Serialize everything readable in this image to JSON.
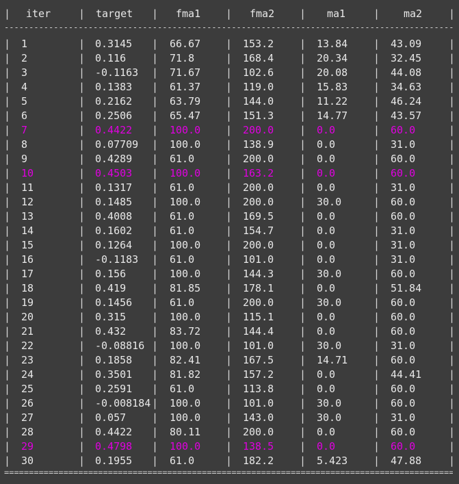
{
  "columns": [
    "iter",
    "target",
    "fma1",
    "fma2",
    "ma1",
    "ma2"
  ],
  "separator_char": "-",
  "footer_char": "=",
  "highlight_color": "#e000e0",
  "rows": [
    {
      "cells": [
        "1",
        "0.3145",
        "66.67",
        "153.2",
        "13.84",
        "43.09"
      ],
      "highlight": false
    },
    {
      "cells": [
        "2",
        "0.116",
        "71.8",
        "168.4",
        "20.34",
        "32.45"
      ],
      "highlight": false
    },
    {
      "cells": [
        "3",
        "-0.1163",
        "71.67",
        "102.6",
        "20.08",
        "44.08"
      ],
      "highlight": false
    },
    {
      "cells": [
        "4",
        "0.1383",
        "61.37",
        "119.0",
        "15.83",
        "34.63"
      ],
      "highlight": false
    },
    {
      "cells": [
        "5",
        "0.2162",
        "63.79",
        "144.0",
        "11.22",
        "46.24"
      ],
      "highlight": false
    },
    {
      "cells": [
        "6",
        "0.2506",
        "65.47",
        "151.3",
        "14.77",
        "43.57"
      ],
      "highlight": false
    },
    {
      "cells": [
        "7",
        "0.4422",
        "100.0",
        "200.0",
        "0.0",
        "60.0"
      ],
      "highlight": true
    },
    {
      "cells": [
        "8",
        "0.07709",
        "100.0",
        "138.9",
        "0.0",
        "31.0"
      ],
      "highlight": false
    },
    {
      "cells": [
        "9",
        "0.4289",
        "61.0",
        "200.0",
        "0.0",
        "60.0"
      ],
      "highlight": false
    },
    {
      "cells": [
        "10",
        "0.4503",
        "100.0",
        "163.2",
        "0.0",
        "60.0"
      ],
      "highlight": true
    },
    {
      "cells": [
        "11",
        "0.1317",
        "61.0",
        "200.0",
        "0.0",
        "31.0"
      ],
      "highlight": false
    },
    {
      "cells": [
        "12",
        "0.1485",
        "100.0",
        "200.0",
        "30.0",
        "60.0"
      ],
      "highlight": false
    },
    {
      "cells": [
        "13",
        "0.4008",
        "61.0",
        "169.5",
        "0.0",
        "60.0"
      ],
      "highlight": false
    },
    {
      "cells": [
        "14",
        "0.1602",
        "61.0",
        "154.7",
        "0.0",
        "31.0"
      ],
      "highlight": false
    },
    {
      "cells": [
        "15",
        "0.1264",
        "100.0",
        "200.0",
        "0.0",
        "31.0"
      ],
      "highlight": false
    },
    {
      "cells": [
        "16",
        "-0.1183",
        "61.0",
        "101.0",
        "0.0",
        "31.0"
      ],
      "highlight": false
    },
    {
      "cells": [
        "17",
        "0.156",
        "100.0",
        "144.3",
        "30.0",
        "60.0"
      ],
      "highlight": false
    },
    {
      "cells": [
        "18",
        "0.419",
        "81.85",
        "178.1",
        "0.0",
        "51.84"
      ],
      "highlight": false
    },
    {
      "cells": [
        "19",
        "0.1456",
        "61.0",
        "200.0",
        "30.0",
        "60.0"
      ],
      "highlight": false
    },
    {
      "cells": [
        "20",
        "0.315",
        "100.0",
        "115.1",
        "0.0",
        "60.0"
      ],
      "highlight": false
    },
    {
      "cells": [
        "21",
        "0.432",
        "83.72",
        "144.4",
        "0.0",
        "60.0"
      ],
      "highlight": false
    },
    {
      "cells": [
        "22",
        "-0.08816",
        "100.0",
        "101.0",
        "30.0",
        "31.0"
      ],
      "highlight": false
    },
    {
      "cells": [
        "23",
        "0.1858",
        "82.41",
        "167.5",
        "14.71",
        "60.0"
      ],
      "highlight": false
    },
    {
      "cells": [
        "24",
        "0.3501",
        "81.82",
        "157.2",
        "0.0",
        "44.41"
      ],
      "highlight": false
    },
    {
      "cells": [
        "25",
        "0.2591",
        "61.0",
        "113.8",
        "0.0",
        "60.0"
      ],
      "highlight": false
    },
    {
      "cells": [
        "26",
        "-0.008184",
        "100.0",
        "101.0",
        "30.0",
        "60.0"
      ],
      "highlight": false
    },
    {
      "cells": [
        "27",
        "0.057",
        "100.0",
        "143.0",
        "30.0",
        "31.0"
      ],
      "highlight": false
    },
    {
      "cells": [
        "28",
        "0.4422",
        "80.11",
        "200.0",
        "0.0",
        "60.0"
      ],
      "highlight": false
    },
    {
      "cells": [
        "29",
        "0.4798",
        "100.0",
        "138.5",
        "0.0",
        "60.0"
      ],
      "highlight": true
    },
    {
      "cells": [
        "30",
        "0.1955",
        "61.0",
        "182.2",
        "5.423",
        "47.88"
      ],
      "highlight": false
    }
  ]
}
